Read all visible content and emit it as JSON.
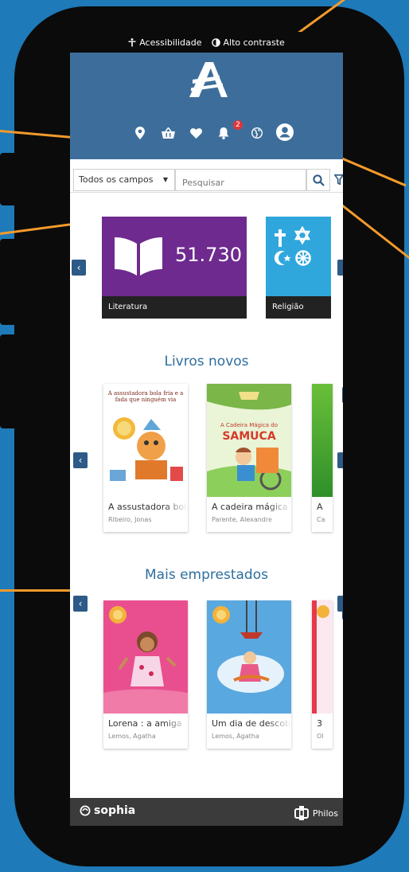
{
  "topbar": {
    "accessibility": "Acessibilidade",
    "contrast": "Alto contraste"
  },
  "header": {
    "logo_icon": "library-logo-icon",
    "notifications_count": "2",
    "icons": [
      "location-icon",
      "basket-icon",
      "heart-icon",
      "bell-icon",
      "globe-icon",
      "user-icon"
    ]
  },
  "search": {
    "field": "Todos os campos",
    "placeholder": "Pesquisar"
  },
  "categories": [
    {
      "label": "Literatura",
      "count": "51.730",
      "color": "#6e2a8e"
    },
    {
      "label": "Religião",
      "color": "#2fa7dd"
    }
  ],
  "new_books": {
    "title": "Livros novos",
    "items": [
      {
        "title": "A assustadora bola fria e a fada que ninguém via",
        "author": "Ribeiro, Jonas",
        "cover_title": "A assustadora bola fria e a fada que ninguém via"
      },
      {
        "title": "A cadeira mágica",
        "author": "Parente, Alexandre",
        "cover_title": "A Cadeira Mágica do",
        "cover_name": "SAMUCA"
      },
      {
        "title": "A",
        "author": "Ca"
      }
    ]
  },
  "most_borrowed": {
    "title": "Mais emprestados",
    "items": [
      {
        "title": "Lorena : a amiga",
        "author": "Lemos, Ágatha"
      },
      {
        "title": "Um dia de descoberta",
        "author": "Lemos, Ágatha"
      },
      {
        "title": "3",
        "author": "Ol"
      }
    ]
  },
  "footer": {
    "brand": "sophia",
    "partner": "Philos"
  }
}
